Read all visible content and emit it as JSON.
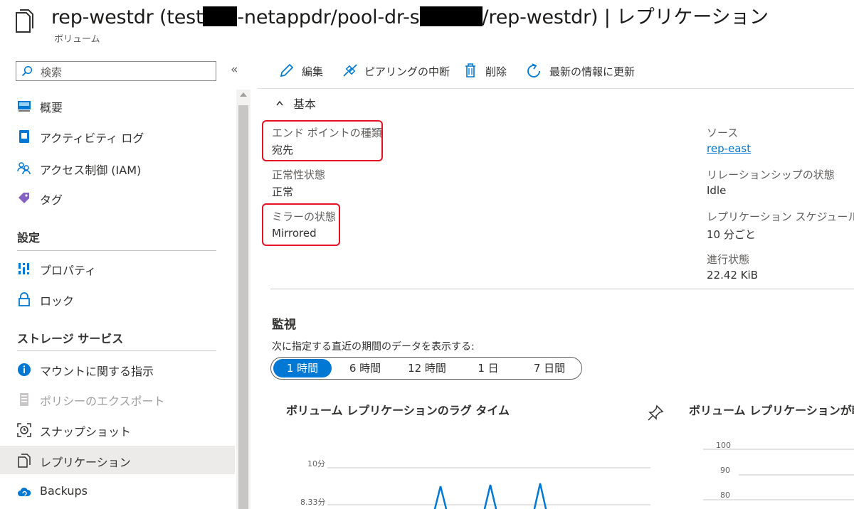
{
  "header": {
    "title_parts": [
      "rep-westdr (test",
      "-netappdr/pool-dr-s",
      "/rep-westdr) | レプリケーション"
    ],
    "subtitle": "ボリューム"
  },
  "sidebar": {
    "search_placeholder": "検索",
    "collapse_glyph": "«",
    "items": [
      {
        "label": "概要",
        "icon": "overview-icon"
      },
      {
        "label": "アクティビティ ログ",
        "icon": "activity-log-icon"
      },
      {
        "label": "アクセス制御 (IAM)",
        "icon": "iam-icon"
      },
      {
        "label": "タグ",
        "icon": "tag-icon"
      }
    ],
    "section_settings": "設定",
    "settings_items": [
      {
        "label": "プロパティ",
        "icon": "properties-icon"
      },
      {
        "label": "ロック",
        "icon": "lock-icon"
      }
    ],
    "section_storage": "ストレージ サービス",
    "storage_items": [
      {
        "label": "マウントに関する指示",
        "icon": "info-icon"
      },
      {
        "label": "ポリシーのエクスポート",
        "icon": "export-policy-icon"
      },
      {
        "label": "スナップショット",
        "icon": "snapshot-icon"
      },
      {
        "label": "レプリケーション",
        "icon": "replication-icon"
      },
      {
        "label": "Backups",
        "icon": "backup-cloud-icon"
      }
    ]
  },
  "toolbar": {
    "edit": "編集",
    "break_peering": "ピアリングの中断",
    "delete": "削除",
    "refresh": "最新の情報に更新"
  },
  "essentials": {
    "heading": "基本",
    "left": [
      {
        "label": "エンド ポイントの種類",
        "value": "宛先"
      },
      {
        "label": "正常性状態",
        "value": "正常"
      },
      {
        "label": "ミラーの状態",
        "value": "Mirrored"
      }
    ],
    "right": [
      {
        "label": "ソース",
        "value": "rep-east"
      },
      {
        "label": "リレーションシップの状態",
        "value": "Idle"
      },
      {
        "label": "レプリケーション スケジュール",
        "value": "10 分ごと"
      },
      {
        "label": "進行状態",
        "value": "22.42 KiB"
      }
    ]
  },
  "monitoring": {
    "title": "監視",
    "caption": "次に指定する直近の期間のデータを表示する:",
    "ranges": [
      "1 時間",
      "6 時間",
      "12 時間",
      "1 日",
      "7 日間"
    ],
    "selected_range": "1 時間"
  },
  "charts": [
    {
      "title": "ボリューム レプリケーションのラグ タイム",
      "y_ticks": [
        "10分",
        "8.33分"
      ]
    },
    {
      "title": "ボリューム レプリケーションが転送",
      "y_ticks": [
        "100",
        "90",
        "80"
      ]
    }
  ],
  "colors": {
    "accent": "#0078d4",
    "highlight": "#e81123",
    "selected_nav": "#edebe9"
  }
}
